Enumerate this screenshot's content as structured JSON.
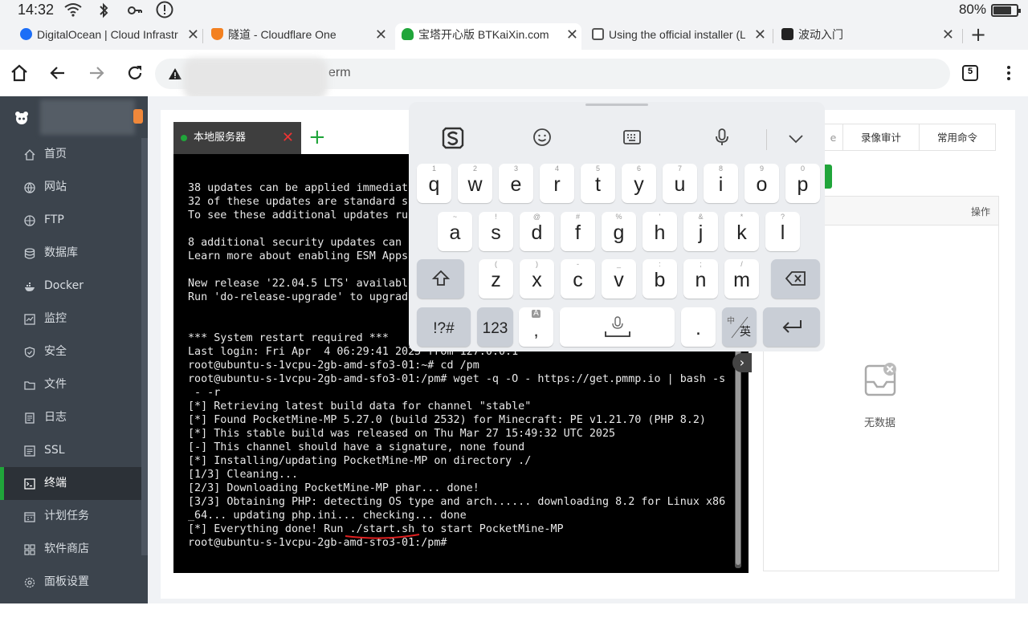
{
  "status_bar": {
    "time": "14:32",
    "battery_percent": "80%",
    "battery_level": 0.8,
    "icons": [
      "wifi-icon",
      "bluetooth-icon",
      "key-icon",
      "alert-icon"
    ]
  },
  "browser_tabs": [
    {
      "title": "DigitalOcean | Cloud Infrastr",
      "favicon": "digitalocean-icon",
      "favicon_color": "#1c6ef7",
      "active": false
    },
    {
      "title": "隧道 - Cloudflare One",
      "favicon": "cloudflare-shield-icon",
      "favicon_color": "#f38020",
      "active": false
    },
    {
      "title": "宝塔开心版 BTKaiXin.com",
      "favicon": "bt-panda-icon",
      "favicon_color": "#20a53a",
      "active": true
    },
    {
      "title": "Using the official installer (L",
      "favicon": "docs-book-icon",
      "favicon_color": "#555555",
      "active": false
    },
    {
      "title": "波动入门",
      "favicon": "pmmp-icon",
      "favicon_color": "#222222",
      "active": false
    }
  ],
  "toolbar": {
    "url_visible": "erm",
    "tab_count": "5",
    "security": "not-secure-warning-icon"
  },
  "sidebar": {
    "items": [
      {
        "label": "首页",
        "icon": "home-icon"
      },
      {
        "label": "网站",
        "icon": "globe-icon"
      },
      {
        "label": "FTP",
        "icon": "ftp-icon"
      },
      {
        "label": "数据库",
        "icon": "database-icon"
      },
      {
        "label": "Docker",
        "icon": "docker-icon"
      },
      {
        "label": "监控",
        "icon": "monitor-icon"
      },
      {
        "label": "安全",
        "icon": "shield-icon"
      },
      {
        "label": "文件",
        "icon": "folder-icon"
      },
      {
        "label": "日志",
        "icon": "log-icon"
      },
      {
        "label": "SSL",
        "icon": "ssl-icon"
      },
      {
        "label": "终端",
        "icon": "terminal-icon",
        "active": true
      },
      {
        "label": "计划任务",
        "icon": "calendar-icon"
      },
      {
        "label": "软件商店",
        "icon": "apps-icon"
      },
      {
        "label": "面板设置",
        "icon": "settings-icon"
      }
    ],
    "accent": "#20a53a"
  },
  "terminal": {
    "tab_label": "本地服务器",
    "lines": [
      "38 updates can be applied immediate",
      "32 of these updates are standard se",
      "To see these additional updates run",
      "",
      "8 additional security updates can b",
      "Learn more about enabling ESM Apps",
      "",
      "New release '22.04.5 LTS' available",
      "Run 'do-release-upgrade' to upgrade",
      "",
      "",
      "*** System restart required ***",
      "Last login: Fri Apr  4 06:29:41 2025 from 127.0.0.1",
      "root@ubuntu-s-1vcpu-2gb-amd-sfo3-01:~# cd /pm",
      "root@ubuntu-s-1vcpu-2gb-amd-sfo3-01:/pm# wget -q -O - https://get.pmmp.io | bash -s",
      " - -r",
      "[*] Retrieving latest build data for channel \"stable\"",
      "[*] Found PocketMine-MP 5.27.0 (build 2532) for Minecraft: PE v1.21.70 (PHP 8.2)",
      "[*] This stable build was released on Thu Mar 27 15:49:32 UTC 2025",
      "[-] This channel should have a signature, none found",
      "[*] Installing/updating PocketMine-MP on directory ./",
      "[1/3] Cleaning...",
      "[2/3] Downloading PocketMine-MP phar... done!",
      "[3/3] Obtaining PHP: detecting OS type and arch...... downloading 8.2 for Linux x86",
      "_64... updating php.ini... checking... done",
      "[*] Everything done! Run ./start.sh to start PocketMine-MP",
      "root@ubuntu-s-1vcpu-2gb-amd-sfo3-01:/pm#"
    ]
  },
  "right_panel": {
    "tabs": [
      "录像审计",
      "常用命令"
    ],
    "partial_tab": "e",
    "column_op": "操作",
    "empty_text": "无数据"
  },
  "keyboard": {
    "row1": [
      {
        "k": "q",
        "h": "1"
      },
      {
        "k": "w",
        "h": "2"
      },
      {
        "k": "e",
        "h": "3"
      },
      {
        "k": "r",
        "h": "4"
      },
      {
        "k": "t",
        "h": "5"
      },
      {
        "k": "y",
        "h": "6"
      },
      {
        "k": "u",
        "h": "7"
      },
      {
        "k": "i",
        "h": "8"
      },
      {
        "k": "o",
        "h": "9"
      },
      {
        "k": "p",
        "h": "0"
      }
    ],
    "row2": [
      {
        "k": "a",
        "h": "~"
      },
      {
        "k": "s",
        "h": "!"
      },
      {
        "k": "d",
        "h": "@"
      },
      {
        "k": "f",
        "h": "#"
      },
      {
        "k": "g",
        "h": "%"
      },
      {
        "k": "h",
        "h": "'"
      },
      {
        "k": "j",
        "h": "&"
      },
      {
        "k": "k",
        "h": "*"
      },
      {
        "k": "l",
        "h": "?"
      }
    ],
    "row3": [
      {
        "k": "z",
        "h": "("
      },
      {
        "k": "x",
        "h": ")"
      },
      {
        "k": "c",
        "h": "-"
      },
      {
        "k": "v",
        "h": "_"
      },
      {
        "k": "b",
        "h": ":"
      },
      {
        "k": "n",
        "h": ";"
      },
      {
        "k": "m",
        "h": "/"
      }
    ],
    "symbols_label": "!?#",
    "numbers_label": "123",
    "comma_label": ",",
    "comma_hint": "A",
    "period_label": ".",
    "lang_top": "中",
    "lang_bottom": "英"
  }
}
